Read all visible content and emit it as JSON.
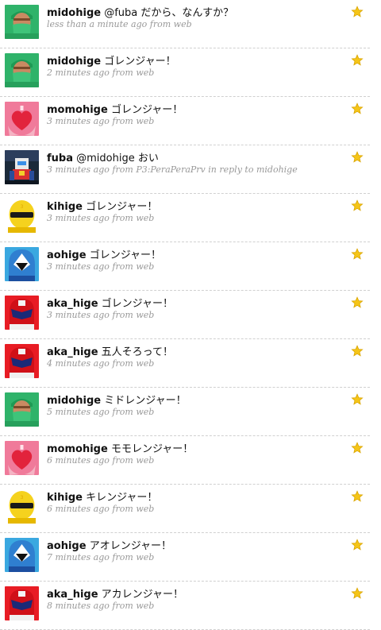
{
  "star_color": "#f5c518",
  "tweets": [
    {
      "user": "midohige",
      "text": "@fuba だから、なんすか？",
      "time": "less than a minute ago",
      "from_prefix": "from",
      "source": "web",
      "reply_prefix": "",
      "reply_to": "",
      "avatar": "green-surgeon"
    },
    {
      "user": "midohige",
      "text": "ゴレンジャー！",
      "time": "2 minutes ago",
      "from_prefix": "from",
      "source": "web",
      "reply_prefix": "",
      "reply_to": "",
      "avatar": "green-surgeon"
    },
    {
      "user": "momohige",
      "text": "ゴレンジャー！",
      "time": "3 minutes ago",
      "from_prefix": "from",
      "source": "web",
      "reply_prefix": "",
      "reply_to": "",
      "avatar": "pink-heart"
    },
    {
      "user": "fuba",
      "text": "@midohige おい",
      "time": "3 minutes ago",
      "from_prefix": "from",
      "source": "P3:PeraPeraPrv",
      "reply_prefix": "in reply to",
      "reply_to": "midohige",
      "avatar": "robot"
    },
    {
      "user": "kihige",
      "text": "ゴレンジャー！",
      "time": "3 minutes ago",
      "from_prefix": "from",
      "source": "web",
      "reply_prefix": "",
      "reply_to": "",
      "avatar": "yellow-ranger"
    },
    {
      "user": "aohige",
      "text": "ゴレンジャー！",
      "time": "3 minutes ago",
      "from_prefix": "from",
      "source": "web",
      "reply_prefix": "",
      "reply_to": "",
      "avatar": "blue-ranger"
    },
    {
      "user": "aka_hige",
      "text": "ゴレンジャー！",
      "time": "3 minutes ago",
      "from_prefix": "from",
      "source": "web",
      "reply_prefix": "",
      "reply_to": "",
      "avatar": "red-ranger"
    },
    {
      "user": "aka_hige",
      "text": "五人そろって！",
      "time": "4 minutes ago",
      "from_prefix": "from",
      "source": "web",
      "reply_prefix": "",
      "reply_to": "",
      "avatar": "red-ranger"
    },
    {
      "user": "midohige",
      "text": "ミドレンジャー！",
      "time": "5 minutes ago",
      "from_prefix": "from",
      "source": "web",
      "reply_prefix": "",
      "reply_to": "",
      "avatar": "green-surgeon"
    },
    {
      "user": "momohige",
      "text": "モモレンジャー！",
      "time": "6 minutes ago",
      "from_prefix": "from",
      "source": "web",
      "reply_prefix": "",
      "reply_to": "",
      "avatar": "pink-heart"
    },
    {
      "user": "kihige",
      "text": "キレンジャー！",
      "time": "6 minutes ago",
      "from_prefix": "from",
      "source": "web",
      "reply_prefix": "",
      "reply_to": "",
      "avatar": "yellow-ranger"
    },
    {
      "user": "aohige",
      "text": "アオレンジャー！",
      "time": "7 minutes ago",
      "from_prefix": "from",
      "source": "web",
      "reply_prefix": "",
      "reply_to": "",
      "avatar": "blue-ranger"
    },
    {
      "user": "aka_hige",
      "text": "アカレンジャー！",
      "time": "8 minutes ago",
      "from_prefix": "from",
      "source": "web",
      "reply_prefix": "",
      "reply_to": "",
      "avatar": "red-ranger"
    }
  ]
}
